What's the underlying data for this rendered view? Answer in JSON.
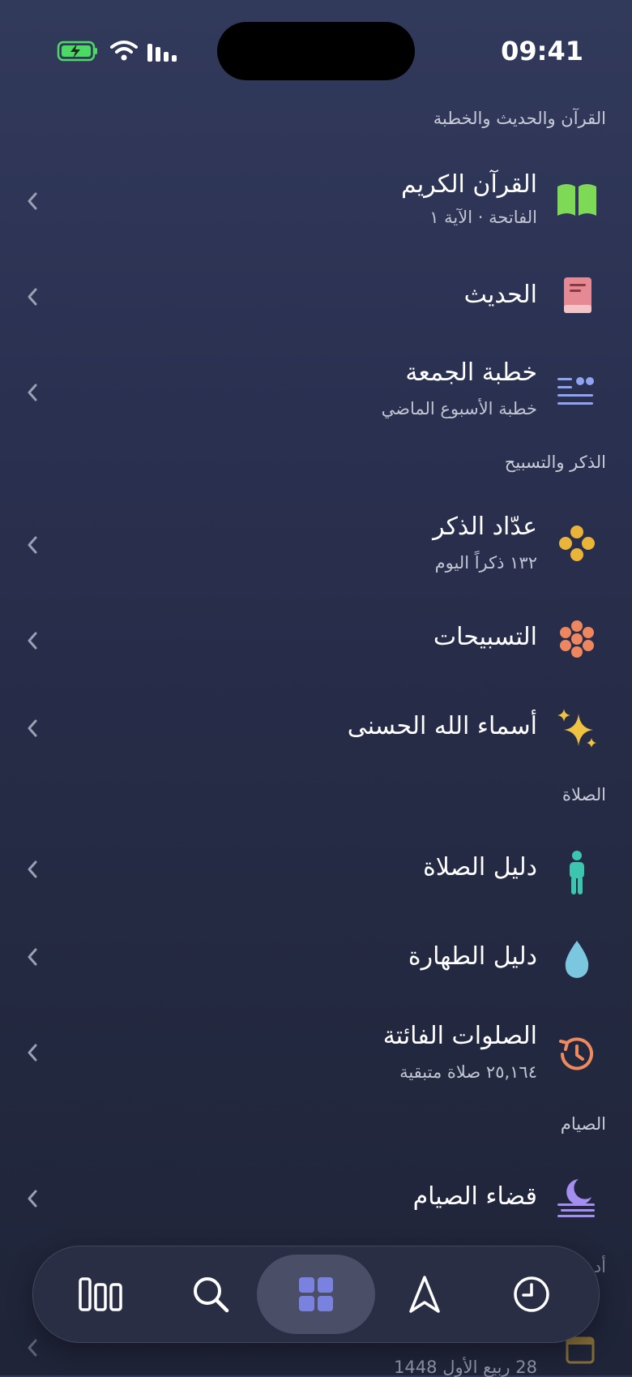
{
  "status": {
    "time": "09:41"
  },
  "sections": [
    {
      "header": "القرآن والحديث والخطبة"
    },
    {
      "header": "الذكر والتسبيح"
    },
    {
      "header": "الصلاة"
    },
    {
      "header": "الصيام"
    }
  ],
  "items": {
    "quran": {
      "title": "القرآن الكريم",
      "subtitle": "الفاتحة · الآية ١",
      "icon": "open-book-icon",
      "color": "#7ed957"
    },
    "hadith": {
      "title": "الحديث",
      "icon": "book-icon",
      "color": "#e58a94"
    },
    "khutbah": {
      "title": "خطبة الجمعة",
      "subtitle": "خطبة الأسبوع الماضي",
      "icon": "quote-lines-icon",
      "color": "#8fa3f0"
    },
    "dhikr_counter": {
      "title": "عدّاد الذكر",
      "subtitle": "١٣٢ ذكراً اليوم",
      "icon": "beads-icon",
      "color": "#e8b53a"
    },
    "tasbihat": {
      "title": "التسبيحات",
      "icon": "flower-beads-icon",
      "color": "#ee8660"
    },
    "asma": {
      "title": "أسماء الله الحسنى",
      "icon": "sparkles-icon",
      "color": "#f0c243"
    },
    "salah_guide": {
      "title": "دليل الصلاة",
      "icon": "person-standing-icon",
      "color": "#3cc6b0"
    },
    "taharah_guide": {
      "title": "دليل الطهارة",
      "icon": "water-drop-icon",
      "color": "#7cc7e0"
    },
    "missed_prayers": {
      "title": "الصلوات الفائتة",
      "subtitle": "٢٥,١٦٤ صلاة متبقية",
      "icon": "history-clock-icon",
      "color": "#ee8a60"
    },
    "qada_siyam": {
      "title": "قضاء الصيام",
      "icon": "moon-fog-icon",
      "color": "#a48ef0"
    }
  },
  "partial": {
    "header_fragment": "أد",
    "subtitle": "28 ربيع الأول 1448"
  },
  "tabbar": {
    "tabs": [
      {
        "name": "library",
        "icon": "library-books-icon"
      },
      {
        "name": "search",
        "icon": "search-icon"
      },
      {
        "name": "grid",
        "icon": "grid-icon",
        "active": true
      },
      {
        "name": "qibla",
        "icon": "navigation-arrow-icon"
      },
      {
        "name": "prayer-times",
        "icon": "clock-icon"
      }
    ],
    "active_color": "#7a82e0"
  }
}
